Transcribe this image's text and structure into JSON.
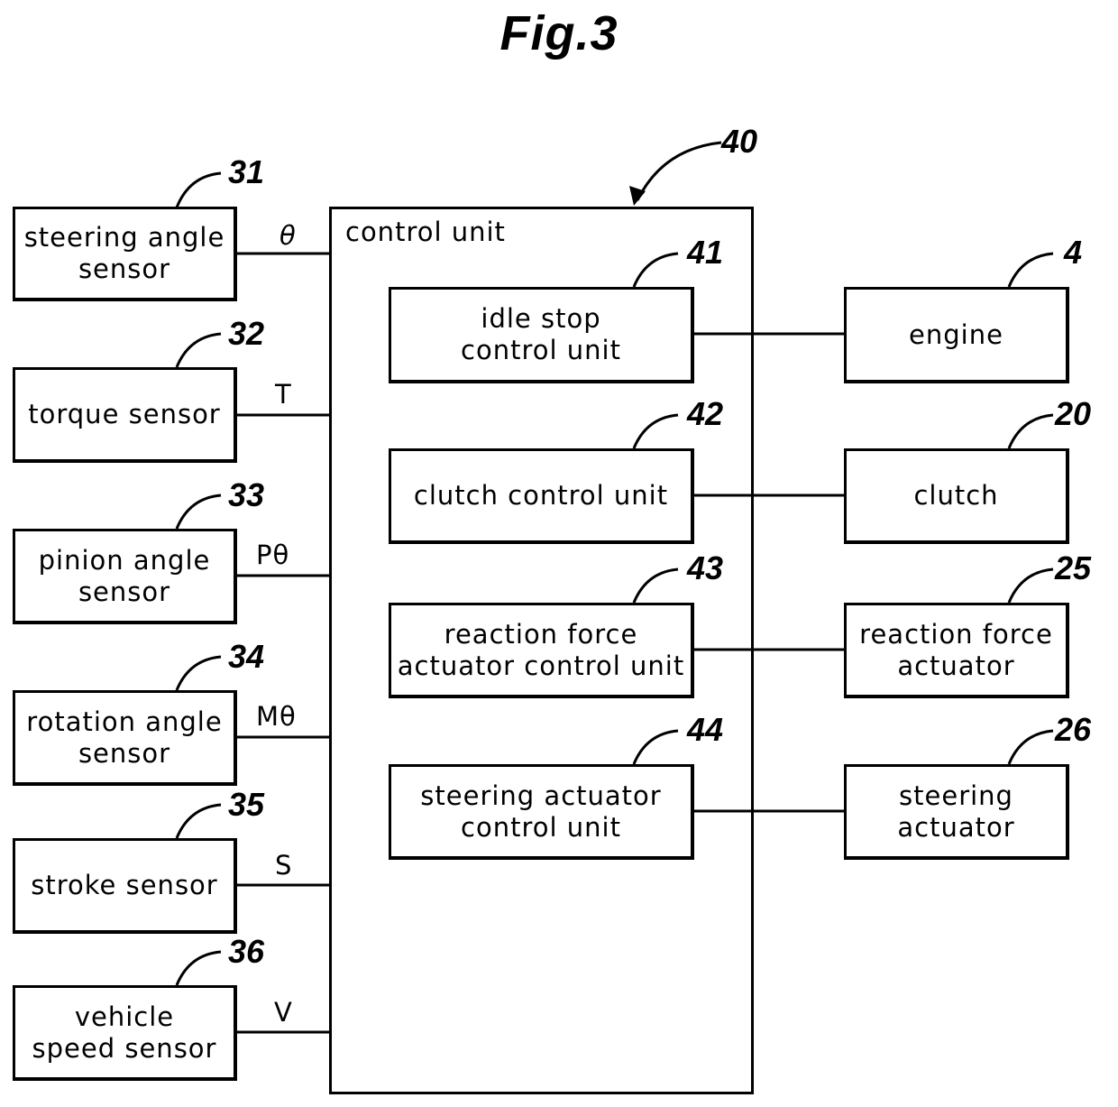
{
  "figure": {
    "title": "Fig.3"
  },
  "control_unit": {
    "label": "control unit",
    "ref": "40"
  },
  "sensors": [
    {
      "label": "steering angle\nsensor",
      "ref": "31",
      "signal": "θ"
    },
    {
      "label": "torque sensor",
      "ref": "32",
      "signal": "T"
    },
    {
      "label": "pinion angle\nsensor",
      "ref": "33",
      "signal": "Pθ"
    },
    {
      "label": "rotation angle\nsensor",
      "ref": "34",
      "signal": "Mθ"
    },
    {
      "label": "stroke sensor",
      "ref": "35",
      "signal": "S"
    },
    {
      "label": "vehicle\nspeed sensor",
      "ref": "36",
      "signal": "V"
    }
  ],
  "sub_units": [
    {
      "label": "idle stop\ncontrol unit",
      "ref": "41"
    },
    {
      "label": "clutch control unit",
      "ref": "42"
    },
    {
      "label": "reaction force\nactuator control unit",
      "ref": "43"
    },
    {
      "label": "steering actuator\ncontrol unit",
      "ref": "44"
    }
  ],
  "devices": [
    {
      "label": "engine",
      "ref": "4"
    },
    {
      "label": "clutch",
      "ref": "20"
    },
    {
      "label": "reaction force\nactuator",
      "ref": "25"
    },
    {
      "label": "steering\nactuator",
      "ref": "26"
    }
  ]
}
